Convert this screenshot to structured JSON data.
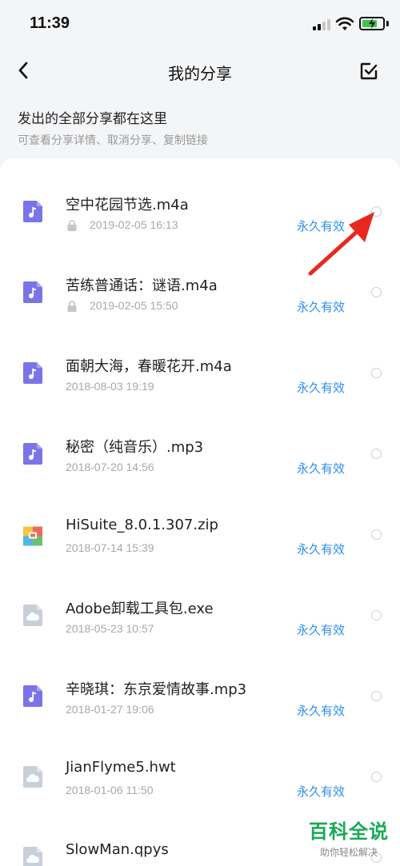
{
  "status_bar": {
    "time": "11:39"
  },
  "nav": {
    "title": "我的分享"
  },
  "intro": {
    "title": "发出的全部分享都在这里",
    "subtitle": "可查看分享详情、取消分享、复制链接"
  },
  "files": [
    {
      "name": "空中花园节选.m4a",
      "date": "2019-02-05 16:13",
      "validity": "永久有效",
      "icon": "music-file-icon",
      "locked": true
    },
    {
      "name": "苦练普通话：谜语.m4a",
      "date": "2019-02-05 15:50",
      "validity": "永久有效",
      "icon": "music-file-icon",
      "locked": true
    },
    {
      "name": "面朝大海，春暖花开.m4a",
      "date": "2018-08-03 19:19",
      "validity": "永久有效",
      "icon": "music-file-icon",
      "locked": false
    },
    {
      "name": "秘密（纯音乐）.mp3",
      "date": "2018-07-20 14:56",
      "validity": "永久有效",
      "icon": "music-file-icon",
      "locked": false
    },
    {
      "name": "HiSuite_8.0.1.307.zip",
      "date": "2018-07-14 15:39",
      "validity": "永久有效",
      "icon": "zip-file-icon",
      "locked": false
    },
    {
      "name": "Adobe卸载工具包.exe",
      "date": "2018-05-23 10:57",
      "validity": "永久有效",
      "icon": "cloud-file-icon",
      "locked": false
    },
    {
      "name": "辛晓琪：东京爱情故事.mp3",
      "date": "2018-01-27 19:06",
      "validity": "永久有效",
      "icon": "music-file-icon",
      "locked": false
    },
    {
      "name": "JianFlyme5.hwt",
      "date": "2018-01-06 11:50",
      "validity": "永久有效",
      "icon": "cloud-file-icon",
      "locked": false
    },
    {
      "name": "SlowMan.qpys",
      "date": "",
      "validity": "",
      "icon": "cloud-file-icon",
      "locked": false
    }
  ],
  "watermark": {
    "main": "百科全说",
    "sub": "助你轻松解决"
  },
  "colors": {
    "accent": "#2b8ff0",
    "music_icon": "#7b74e8",
    "cloud_icon": "#c7d0da",
    "annotation_arrow": "#e8281e"
  }
}
